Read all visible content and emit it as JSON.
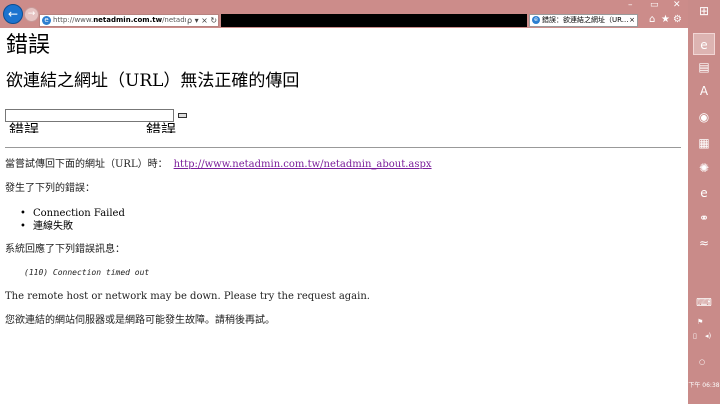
{
  "browser": {
    "address_url_prefix": "http://www.",
    "address_url_domain": "netadmin.com.tw",
    "address_url_rest": "/netadmin_about.",
    "address_controls": "ρ ▾ ×  ↻",
    "tab_title": "錯誤：欲連結之網址（UR...",
    "tab_close": "×",
    "window_controls": {
      "minimize": "–",
      "restore": "▭",
      "close": "✕"
    },
    "toolbar_icons": [
      "home-icon",
      "favorites-icon",
      "settings-icon"
    ],
    "toolbar_glyphs": {
      "home": "⌂",
      "favorites": "★",
      "settings": "⚙"
    }
  },
  "page": {
    "title": "錯誤",
    "subtitle": "欲連結之網址（URL）無法正確的傳回",
    "broken_label_1": "錯誤",
    "broken_label_2": "錯誤",
    "attempt_text": "當嘗試傳回下面的網址（URL）時：",
    "attempt_url": "http://www.netadmin.com.tw/netadmin_about.aspx",
    "error_intro": "發生了下列的錯誤：",
    "errors": [
      "Connection Failed",
      "連線失敗"
    ],
    "bullet_glyph": "•",
    "system_reply": "系統回應了下列錯誤訊息：",
    "system_message": "(110) Connection timed out",
    "advice_en": "The remote host or network may be down. Please try the request again.",
    "advice_zh": "您欲連結的網站伺服器或是網路可能發生故障。請稍後再試。"
  },
  "taskbar": {
    "apps": [
      {
        "name": "windows-icon",
        "glyph": "⊞"
      },
      {
        "name": "ie-icon",
        "glyph": "e"
      },
      {
        "name": "file-explorer-icon",
        "glyph": "▤"
      },
      {
        "name": "acrobat-icon",
        "glyph": "A"
      },
      {
        "name": "chrome-icon",
        "glyph": "◉"
      },
      {
        "name": "notepad-icon",
        "glyph": "▦"
      },
      {
        "name": "media-icon",
        "glyph": "✺"
      },
      {
        "name": "ie-alt-icon",
        "glyph": "e"
      },
      {
        "name": "network-app-icon",
        "glyph": "⚭"
      },
      {
        "name": "remote-app-icon",
        "glyph": "≈"
      }
    ],
    "tray_icons": [
      {
        "name": "keyboard-icon",
        "glyph": "⌨"
      },
      {
        "name": "flag-icon",
        "glyph": "⚑"
      },
      {
        "name": "network-icon",
        "glyph": "▯"
      },
      {
        "name": "volume-icon",
        "glyph": "◂)"
      },
      {
        "name": "status-icon",
        "glyph": "○"
      }
    ],
    "clock": "下午 06:38"
  }
}
